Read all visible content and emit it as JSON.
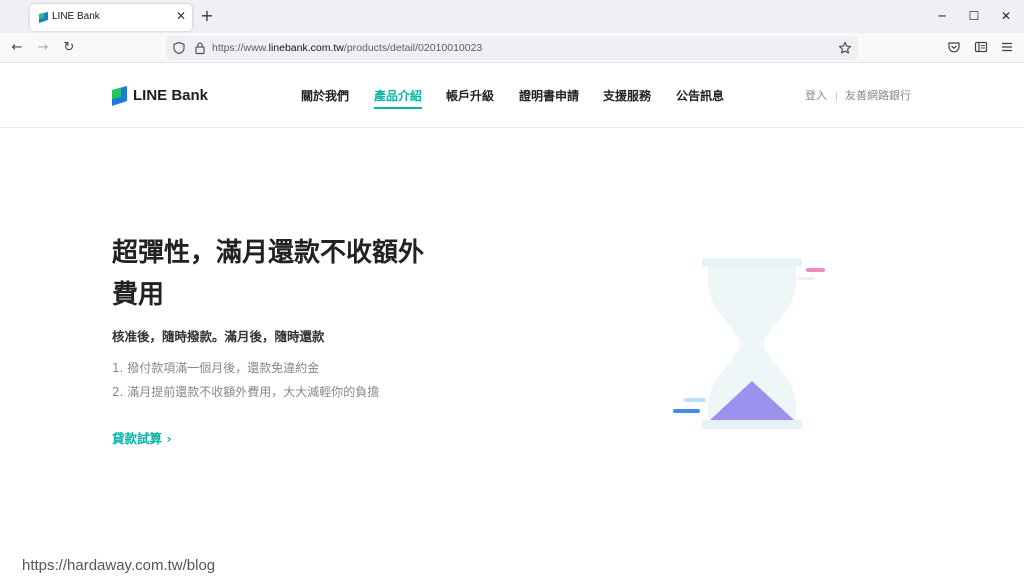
{
  "browser": {
    "tab_title": "LINE Bank",
    "tab_close": "✕",
    "new_tab": "+",
    "minimize": "─",
    "maximize": "☐",
    "close": "✕",
    "back": "←",
    "forward": "→",
    "reload": "↻",
    "url_scheme": "https://www.",
    "url_host": "linebank.com.tw",
    "url_path": "/products/detail/02010010023"
  },
  "site": {
    "brand": "LINE Bank",
    "brand_color": "#06b5a6",
    "menu": [
      {
        "label": "關於我們"
      },
      {
        "label": "產品介紹"
      },
      {
        "label": "帳戶升級"
      },
      {
        "label": "證明書申請"
      },
      {
        "label": "支援服務"
      },
      {
        "label": "公告訊息"
      }
    ],
    "login": "登入",
    "friend_bank": "友善網路銀行"
  },
  "hero": {
    "title_line1": "超彈性，滿月還款不收額外",
    "title_line2": "費用",
    "subtitle": "核准後，隨時撥款。滿月後，隨時還款",
    "points": [
      "1. 撥付款項滿一個月後，還款免違約金",
      "2. 滿月提前還款不收額外費用，大大減輕你的負擔"
    ],
    "link_label": "貸款試算 ›"
  },
  "watermark": "https://hardaway.com.tw/blog"
}
